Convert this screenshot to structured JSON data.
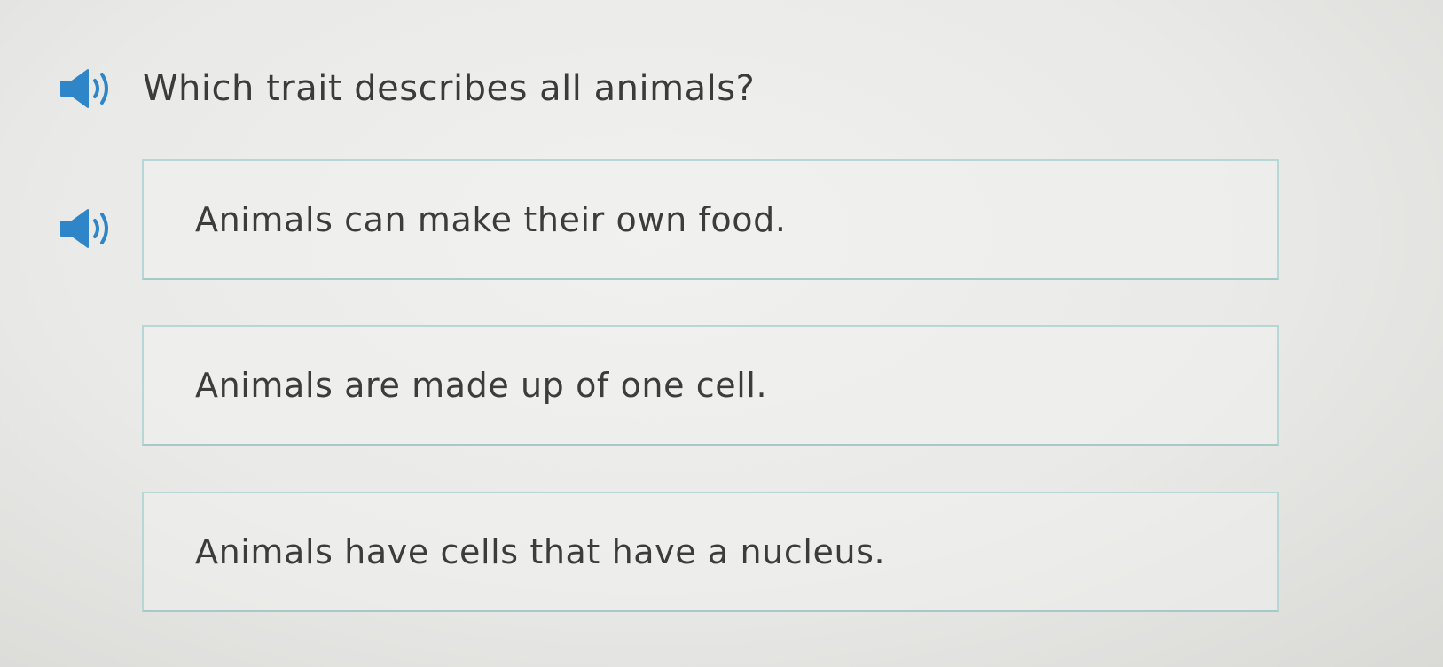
{
  "question": {
    "text": "Which trait describes all animals?",
    "speaker_icon": "speaker-icon"
  },
  "choices": [
    {
      "label": "Animals can make their own food."
    },
    {
      "label": "Animals are made up of one cell."
    },
    {
      "label": "Animals have cells that have a nucleus."
    }
  ],
  "colors": {
    "speaker_blue": "#2e86c8",
    "choice_border": "#b7d6d6",
    "text": "#3c3c3c"
  }
}
